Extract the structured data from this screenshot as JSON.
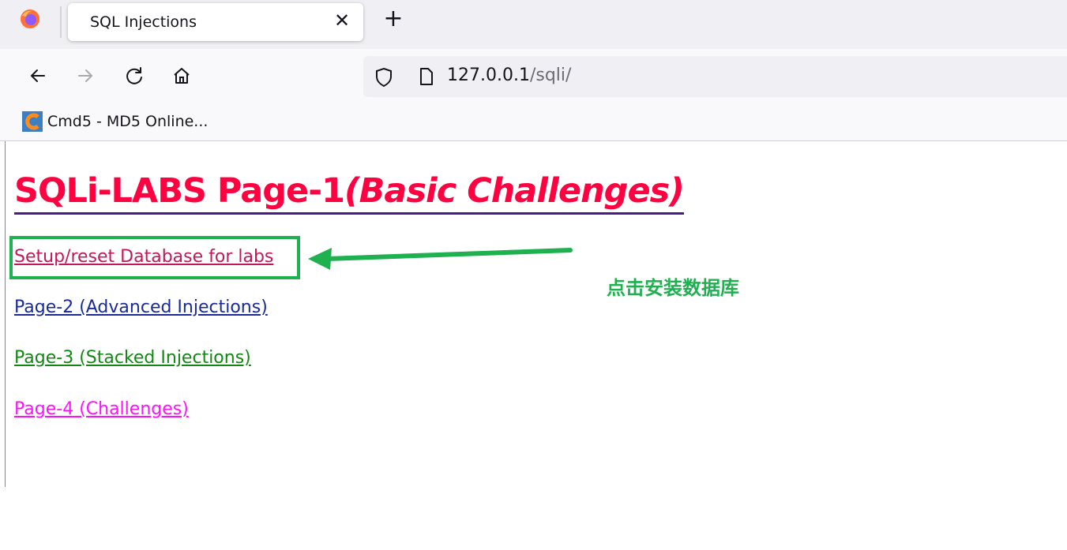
{
  "browser": {
    "tab_title": "SQL Injections",
    "tab_close": "✕",
    "new_tab": "+",
    "url_host": "127.0.0.1",
    "url_path": "/sqli/",
    "bookmark_label": "Cmd5 - MD5 Online..."
  },
  "page": {
    "title_main": "SQLi-LABS Page-1",
    "title_sub": "(Basic Challenges)",
    "links": [
      "Setup/reset Database for labs",
      "Page-2 (Advanced Injections)",
      "Page-3 (Stacked Injections)",
      "Page-4 (Challenges)"
    ]
  },
  "annotation": {
    "text": "点击安装数据库",
    "color": "#1fb050"
  },
  "colors": {
    "title": "#ff0040",
    "link_setup": "#c2185b",
    "link_page2": "#1a2a9a",
    "link_page3": "#118811",
    "link_page4": "#ff10ff"
  },
  "icons": [
    "firefox-logo-icon",
    "close-icon",
    "plus-icon",
    "back-arrow-icon",
    "forward-arrow-icon",
    "reload-icon",
    "home-icon",
    "shield-icon",
    "page-icon",
    "cmd5-favicon-icon"
  ]
}
